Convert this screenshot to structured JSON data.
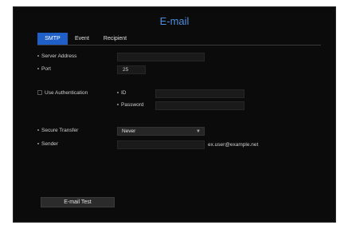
{
  "dialog": {
    "title": "E-mail"
  },
  "tabs": [
    {
      "label": "SMTP",
      "active": true
    },
    {
      "label": "Event",
      "active": false
    },
    {
      "label": "Recipient",
      "active": false
    }
  ],
  "smtp": {
    "server_address": {
      "label": "Server Address",
      "value": ""
    },
    "port": {
      "label": "Port",
      "value": "25"
    },
    "use_authentication": {
      "label": "Use Authentication",
      "checked": false
    },
    "id": {
      "label": "ID",
      "value": ""
    },
    "password": {
      "label": "Password",
      "value": ""
    },
    "secure_transfer": {
      "label": "Secure Transfer",
      "value": "Never"
    },
    "sender": {
      "label": "Sender",
      "value": "",
      "hint": "ex.user@example.net"
    }
  },
  "buttons": {
    "email_test": "E-mail Test"
  },
  "colors": {
    "accent": "#4d8fe0",
    "tab_active": "#1f5fc8",
    "background": "#0b0b0b"
  }
}
